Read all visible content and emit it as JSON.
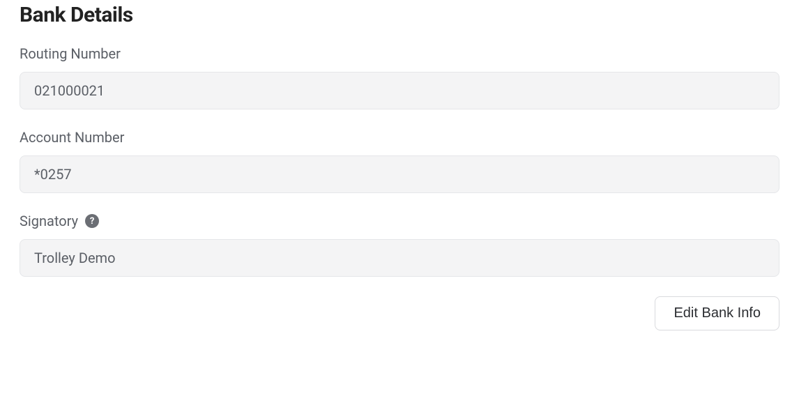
{
  "title": "Bank Details",
  "fields": {
    "routing": {
      "label": "Routing Number",
      "value": "021000021"
    },
    "account": {
      "label": "Account Number",
      "value": "*0257"
    },
    "signatory": {
      "label": "Signatory",
      "value": "Trolley Demo",
      "help": "?"
    }
  },
  "actions": {
    "edit_label": "Edit Bank Info"
  }
}
